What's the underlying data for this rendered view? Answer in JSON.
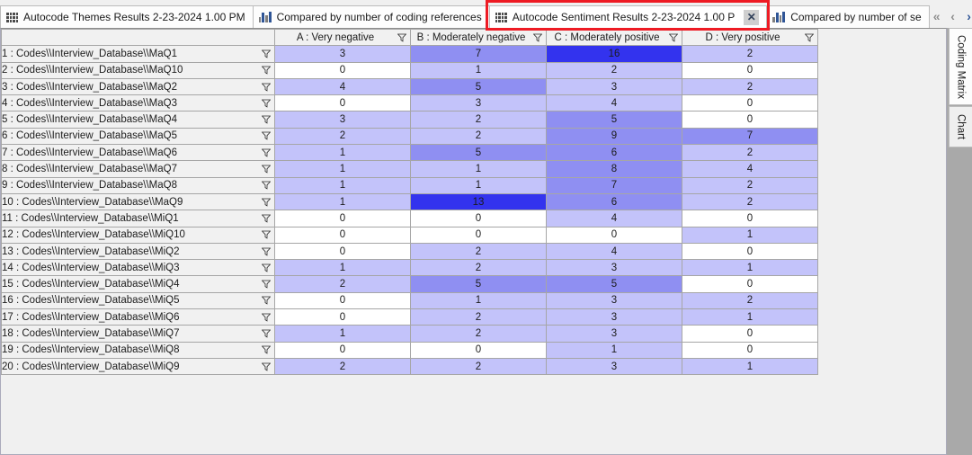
{
  "tabstrip": {
    "tabs": [
      {
        "label": "Autocode Themes Results 2-23-2024 1.00 PM",
        "icon": "grid-icon",
        "active": false,
        "closable": false
      },
      {
        "label": "Compared by number of coding references",
        "icon": "bar-chart-icon",
        "active": false,
        "closable": false
      },
      {
        "label": "Autocode Sentiment Results 2-23-2024 1.00 P",
        "icon": "grid-icon",
        "active": true,
        "closable": true
      },
      {
        "label": "Compared by number of se",
        "icon": "bar-chart-icon",
        "active": false,
        "closable": false
      }
    ],
    "close_label": "✕",
    "nav": {
      "first": "«",
      "prev": "‹",
      "next": "›",
      "last": "»"
    },
    "highlight_color": "#ee1b24"
  },
  "side_tabs": [
    {
      "label": "Coding Matrix",
      "active": true
    },
    {
      "label": "Chart",
      "active": false
    }
  ],
  "matrix": {
    "corner_label": "",
    "columns": [
      "A : Very negative",
      "B : Moderately negative",
      "C : Moderately positive",
      "D : Very positive"
    ],
    "rows": [
      {
        "label": "1 : Codes\\\\Interview_Database\\\\MaQ1",
        "values": [
          3,
          7,
          16,
          2
        ]
      },
      {
        "label": "2 : Codes\\\\Interview_Database\\\\MaQ10",
        "values": [
          0,
          1,
          2,
          0
        ]
      },
      {
        "label": "3 : Codes\\\\Interview_Database\\\\MaQ2",
        "values": [
          4,
          5,
          3,
          2
        ]
      },
      {
        "label": "4 : Codes\\\\Interview_Database\\\\MaQ3",
        "values": [
          0,
          3,
          4,
          0
        ]
      },
      {
        "label": "5 : Codes\\\\Interview_Database\\\\MaQ4",
        "values": [
          3,
          2,
          5,
          0
        ]
      },
      {
        "label": "6 : Codes\\\\Interview_Database\\\\MaQ5",
        "values": [
          2,
          2,
          9,
          7
        ]
      },
      {
        "label": "7 : Codes\\\\Interview_Database\\\\MaQ6",
        "values": [
          1,
          5,
          6,
          2
        ]
      },
      {
        "label": "8 : Codes\\\\Interview_Database\\\\MaQ7",
        "values": [
          1,
          1,
          8,
          4
        ]
      },
      {
        "label": "9 : Codes\\\\Interview_Database\\\\MaQ8",
        "values": [
          1,
          1,
          7,
          2
        ]
      },
      {
        "label": "10 : Codes\\\\Interview_Database\\\\MaQ9",
        "values": [
          1,
          13,
          6,
          2
        ]
      },
      {
        "label": "11 : Codes\\\\Interview_Database\\\\MiQ1",
        "values": [
          0,
          0,
          4,
          0
        ]
      },
      {
        "label": "12 : Codes\\\\Interview_Database\\\\MiQ10",
        "values": [
          0,
          0,
          0,
          1
        ]
      },
      {
        "label": "13 : Codes\\\\Interview_Database\\\\MiQ2",
        "values": [
          0,
          2,
          4,
          0
        ]
      },
      {
        "label": "14 : Codes\\\\Interview_Database\\\\MiQ3",
        "values": [
          1,
          2,
          3,
          1
        ]
      },
      {
        "label": "15 : Codes\\\\Interview_Database\\\\MiQ4",
        "values": [
          2,
          5,
          5,
          0
        ]
      },
      {
        "label": "16 : Codes\\\\Interview_Database\\\\MiQ5",
        "values": [
          0,
          1,
          3,
          2
        ]
      },
      {
        "label": "17 : Codes\\\\Interview_Database\\\\MiQ6",
        "values": [
          0,
          2,
          3,
          1
        ]
      },
      {
        "label": "18 : Codes\\\\Interview_Database\\\\MiQ7",
        "values": [
          1,
          2,
          3,
          0
        ]
      },
      {
        "label": "19 : Codes\\\\Interview_Database\\\\MiQ8",
        "values": [
          0,
          0,
          1,
          0
        ]
      },
      {
        "label": "20 : Codes\\\\Interview_Database\\\\MiQ9",
        "values": [
          2,
          2,
          3,
          1
        ]
      }
    ],
    "heat_colors": {
      "zero": "#ffffff",
      "low": "#c3c3fa",
      "mid": "#8f8ff2",
      "high": "#3333ee"
    },
    "filter_icon": "funnel-icon"
  }
}
